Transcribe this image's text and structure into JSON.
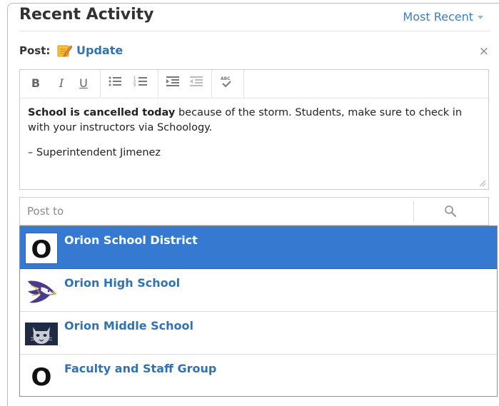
{
  "header": {
    "title": "Recent Activity",
    "sort_label": "Most Recent"
  },
  "composer": {
    "post_label": "Post:",
    "post_type": "Update",
    "close_glyph": "×",
    "toolbar": {
      "bold": "B",
      "italic": "I",
      "underline": "U",
      "bullet_list_icon": "bullet-list-icon",
      "numbered_list_icon": "numbered-list-icon",
      "indent_icon": "indent-icon",
      "outdent_icon": "outdent-icon",
      "spellcheck_icon": "spellcheck-icon"
    },
    "body": {
      "bold_lead": "School is cancelled today",
      "rest": " because of the storm. Students, make sure to check in with your instructors via Schoology.",
      "signature": "– Superintendent Jimenez"
    }
  },
  "post_to": {
    "placeholder": "Post to",
    "options": [
      {
        "label": "Orion School District",
        "logo": "O",
        "selected": true
      },
      {
        "label": "Orion High School",
        "logo": "eagle-logo",
        "selected": false
      },
      {
        "label": "Orion Middle School",
        "logo": "wildcat-logo",
        "selected": false
      },
      {
        "label": "Faculty and Staff Group",
        "logo": "O",
        "selected": false
      }
    ]
  },
  "colors": {
    "accent": "#3d7dbf",
    "selected_bg": "#3579d1",
    "link": "#2f73b5"
  }
}
